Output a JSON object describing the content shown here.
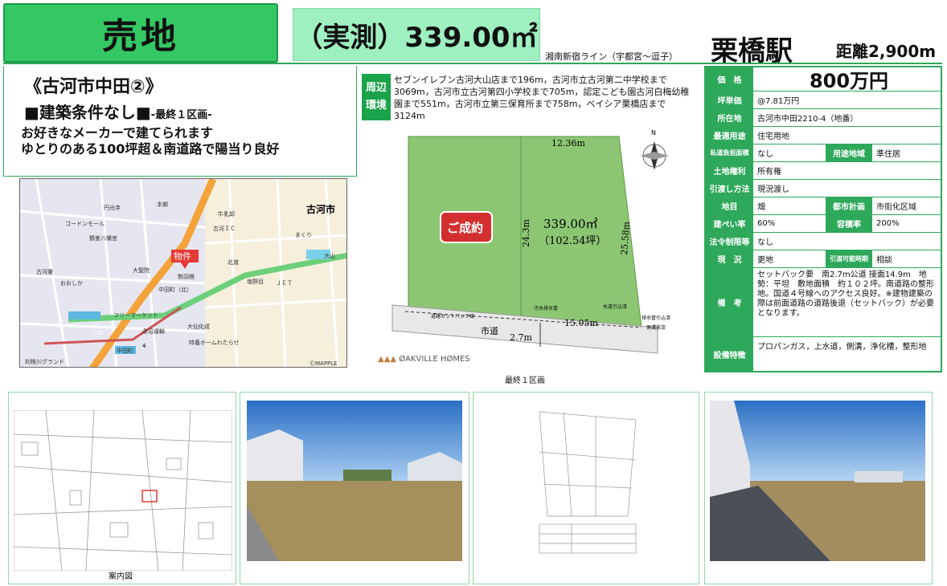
{
  "header": {
    "sale_label": "売地",
    "area_label": "（実測）339.00㎡",
    "line": "湘南新宿ライン（宇都宮〜逗子）",
    "station": "栗橋駅",
    "distance": "距離2,900m"
  },
  "left": {
    "title": "《古河市中田②》",
    "condition_main": "■建築条件なし■",
    "condition_sub": "-最終１区画-",
    "desc1": "お好きなメーカーで建てられます",
    "desc2": "ゆとりのある100坪超＆南道路で陽当り良好"
  },
  "map": {
    "city": "古河市",
    "marker": "物件",
    "labels": [
      "円光寺",
      "ゴードンモール",
      "鶴峯八幡宮",
      "古河署",
      "おおしか",
      "大聖院",
      "本郷",
      "フリーマーケット",
      "永沼運輸",
      "大仙化成",
      "特養ホームわたらせ",
      "中田町",
      "古河ＩＣ",
      "牛乳卸",
      "駒羽根",
      "北渡",
      "塩野目",
      "利根川グランド",
      "ＪＥＴ",
      "中田町（北）",
      "ⒸMAPPLE",
      "大山",
      "まくり"
    ],
    "route_numbers": [
      "226",
      "4"
    ]
  },
  "environment": {
    "label": "周辺環境",
    "text": "セブンイレブン古河大山店まで196m，古河市立古河第二中学校まで3069m，古河市立古河第四小学校まで705m，認定こども園古河白梅幼稚園まで551m，古河市立第三保育所まで758m，ベイシア栗橋店まで3124m"
  },
  "plot": {
    "top_width": "12.36m",
    "left_depth": "24.3m",
    "right_depth": "25.58m",
    "bottom_width": "15.05m",
    "area_m2": "339.00㎡",
    "area_tsubo": "（102.54坪）",
    "sold_stamp": "ご成約",
    "road_name": "市道",
    "road_width": "2.7m",
    "north": "N",
    "note_setback": "道路セットバック線",
    "note_drain": "汚水排水管",
    "note_water": "水道引込済",
    "note_drain2": "排水管引込済",
    "note_ditch": "側溝放流",
    "caption": "最終１区画",
    "logo": "ØAKVILLE HØMES"
  },
  "spec": {
    "price_label": "価　格",
    "price": "800万円",
    "unit_price_label": "坪単価",
    "unit_price": "@7.81万円",
    "address_label": "所在地",
    "address": "古河市中田2210-4（地番）",
    "use_label": "最適用途",
    "use": "住宅用地",
    "private_road_label": "私道負担面積",
    "private_road": "なし",
    "zone_label": "用途地域",
    "zone": "準住居",
    "right_label": "土地権利",
    "right": "所有権",
    "handover_label": "引渡し方法",
    "handover": "現況渡し",
    "category_label": "地目",
    "category": "畑",
    "plan_label": "都市計画",
    "plan": "市街化区域",
    "coverage_label": "建ぺい率",
    "coverage": "60%",
    "far_label": "容積率",
    "far": "200%",
    "law_label": "法令制限等",
    "law": "なし",
    "status_label": "現　況",
    "status": "更地",
    "period_label": "引渡可能時期",
    "period": "相談",
    "remarks_label": "備　考",
    "remarks": "セットバック要　南2.7m公道 接面14.9m　地勢：平坦　敷地面積　約１０２坪。南道路の整形地。国道４号線へのアクセス良好。※建物建築の際は前面道路の道路後退（セットバック）が必要となります。",
    "facilities_label": "設備特徴",
    "facilities": "プロパンガス，上水道，側溝，浄化槽，整形地"
  },
  "photos": {
    "guide_caption": "案内図"
  }
}
